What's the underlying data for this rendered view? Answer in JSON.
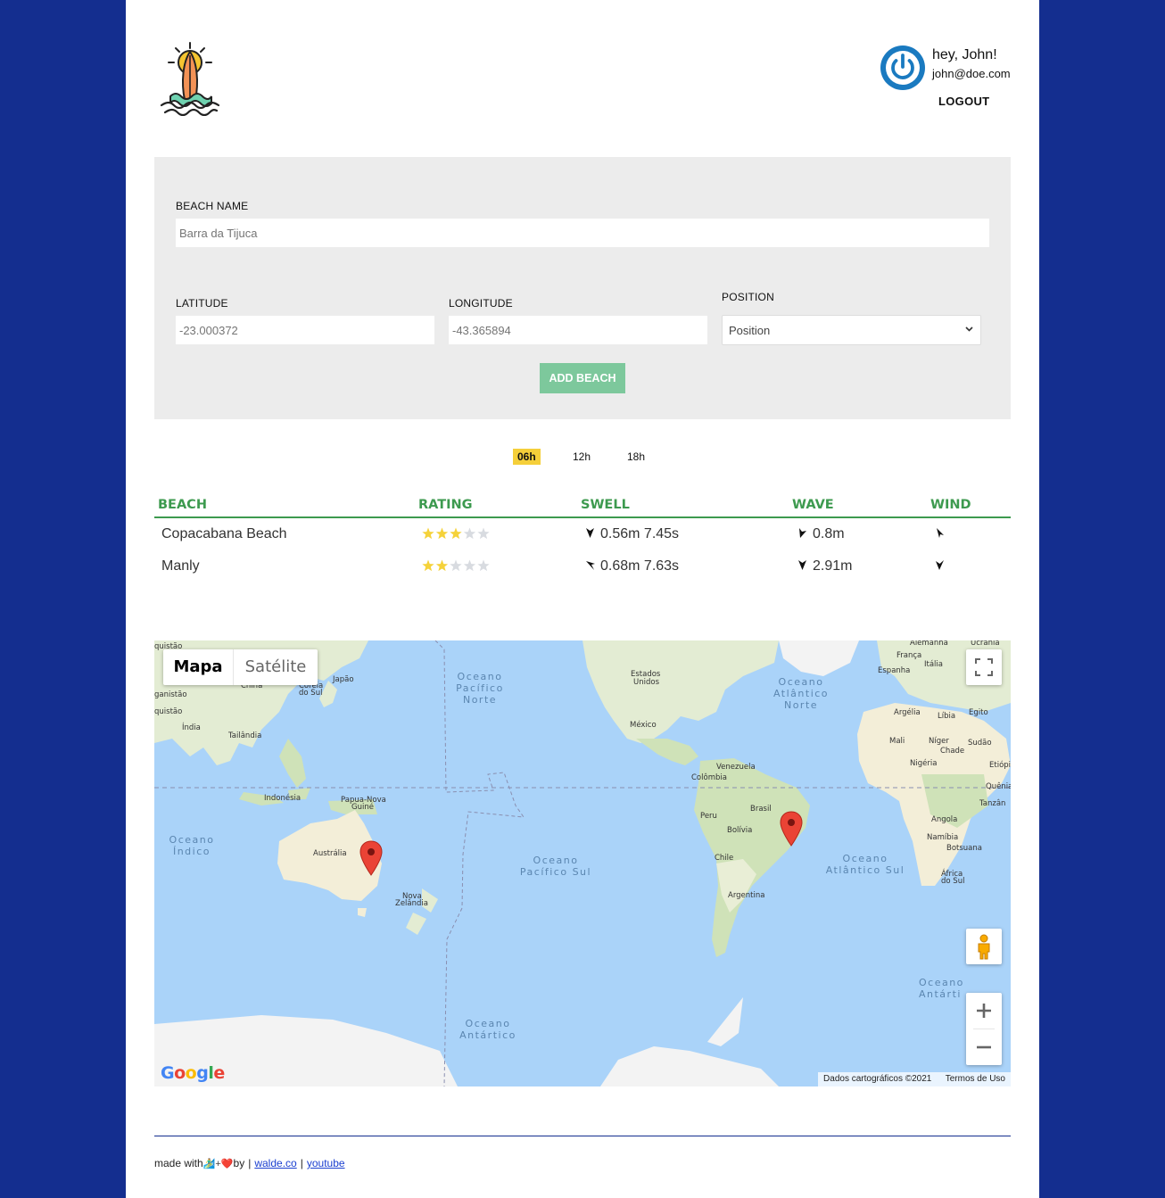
{
  "header": {
    "logo_icon": "surfboard-sun-icon",
    "user": {
      "greeting": "hey, John!",
      "email": "john@doe.com",
      "logout_label": "LOGOUT",
      "avatar_icon": "power-icon"
    }
  },
  "form": {
    "beach_name_label": "BEACH NAME",
    "beach_name_placeholder": "Barra da Tijuca",
    "latitude_label": "LATITUDE",
    "latitude_placeholder": "-23.000372",
    "longitude_label": "LONGITUDE",
    "longitude_placeholder": "-43.365894",
    "position_label": "POSITION",
    "position_value": "Position",
    "submit_label": "ADD BEACH"
  },
  "time_tabs": [
    "06h",
    "12h",
    "18h"
  ],
  "active_tab": "06h",
  "forecast": {
    "columns": [
      "BEACH",
      "RATING",
      "SWELL",
      "WAVE",
      "WIND"
    ],
    "rows": [
      {
        "beach": "Copacabana Beach",
        "rating": 3,
        "swell": "0.56m 7.45s",
        "wave": "0.8m"
      },
      {
        "beach": "Manly",
        "rating": 2,
        "swell": "0.68m 7.63s",
        "wave": "2.91m"
      }
    ],
    "colors": {
      "header": "#3d9a4f",
      "star_on": "#f5d23a",
      "star_off": "#d8dbe0"
    }
  },
  "map": {
    "map_type": [
      "Mapa",
      "Satélite"
    ],
    "active_type": "Mapa",
    "labels": {
      "japao": "Japão",
      "china": "China",
      "coreia": "Coreia",
      "do_sul": "do Sul",
      "india": "Índia",
      "tailandia": "Tailândia",
      "indonesia": "Indonésia",
      "papua": "Papua-Nova",
      "guine": "Guiné",
      "australia": "Austrália",
      "nova": "Nova",
      "zelandia": "Zelândia",
      "estados": "Estados",
      "unidos": "Unidos",
      "mexico": "México",
      "venezuela": "Venezuela",
      "colombia": "Colômbia",
      "peru": "Peru",
      "brasil": "Brasil",
      "bolivia": "Bolívia",
      "chile": "Chile",
      "argentina": "Argentina",
      "alemanha": "Alemanha",
      "ucrania": "Ucrânia",
      "franca": "França",
      "espanha": "Espanha",
      "italia": "Itália",
      "argelia": "Argélia",
      "libia": "Líbia",
      "egito": "Egito",
      "mali": "Mali",
      "niger": "Níger",
      "chade": "Chade",
      "sudao": "Sudão",
      "nigeria": "Nigéria",
      "etiopia": "Etiópi",
      "quenia": "Quênia",
      "tanzania": "Tanzân",
      "angola": "Angola",
      "namibia": "Namíbia",
      "botsuana": "Botsuana",
      "africa": "África",
      "afr_do_sul": "do Sul",
      "ganistao": "ganistão",
      "quistao": "quistão",
      "quistao2": "quistão"
    },
    "oceans": {
      "pac_norte": [
        "Oceano",
        "Pacífico",
        "Norte"
      ],
      "atl_norte": [
        "Oceano",
        "Atlântico",
        "Norte"
      ],
      "indico": [
        "Oceano",
        "Índico"
      ],
      "pac_sul": [
        "Oceano",
        "Pacífico Sul"
      ],
      "atl_sul": [
        "Oceano",
        "Atlântico Sul"
      ],
      "antartico": [
        "Oceano",
        "Antártico"
      ],
      "antartico2": [
        "Oceano",
        "Antárti"
      ]
    },
    "attribution": "Dados cartográficos ©2021",
    "terms": "Termos de Uso",
    "google": "Google"
  },
  "footer": {
    "made_with": "made with",
    "by": "by",
    "link1": "walde.co",
    "link2": "youtube"
  }
}
